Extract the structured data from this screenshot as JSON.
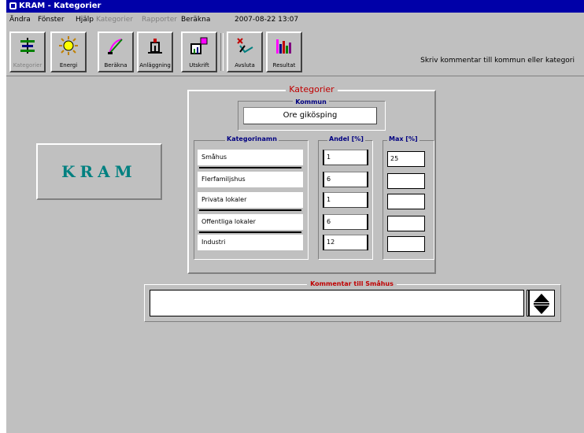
{
  "window": {
    "title": "KRAM - Kategorier"
  },
  "menu": {
    "items": [
      {
        "label": "Ändra",
        "enabled": true
      },
      {
        "label": "Fönster",
        "enabled": true
      },
      {
        "label": "Hjälp",
        "enabled": true
      },
      {
        "label": "Kategorier",
        "enabled": false
      },
      {
        "label": "Rapporter",
        "enabled": false
      },
      {
        "label": "Beräkna",
        "enabled": true
      },
      {
        "label": "2007-08-22  13:07",
        "enabled": true
      }
    ]
  },
  "toolbar": {
    "buttons": [
      {
        "label": "Kategorier",
        "icon": "sliders-icon",
        "enabled": false
      },
      {
        "label": "Energi",
        "icon": "sun-icon",
        "enabled": true
      },
      {
        "label": "Beräkna",
        "icon": "compass-arc-icon",
        "enabled": true
      },
      {
        "label": "Anläggning",
        "icon": "building-icon",
        "enabled": true
      },
      {
        "label": "Utskrift",
        "icon": "save-chart-icon",
        "enabled": true
      },
      {
        "label": "Avsluta",
        "icon": "exit-icon",
        "enabled": true
      },
      {
        "label": "Resultat",
        "icon": "bar-chart-icon",
        "enabled": true
      }
    ],
    "hint": "Skriv kommentar till kommun eller kategori"
  },
  "logo": {
    "text": "KRAM"
  },
  "kategorier": {
    "title": "Kategorier",
    "kommun_label": "Kommun",
    "kommun_value": "Ore gikösping",
    "col_kategori": "Kategorinamn",
    "col_andel": "Andel [%]",
    "col_max": "Max [%]",
    "rows": [
      {
        "name": "Småhus",
        "andel": "1",
        "max": "25"
      },
      {
        "name": "Flerfamiljshus",
        "andel": "6",
        "max": ""
      },
      {
        "name": "Privata lokaler",
        "andel": "1",
        "max": ""
      },
      {
        "name": "Offentliga lokaler",
        "andel": "6",
        "max": ""
      },
      {
        "name": "Industri",
        "andel": "12",
        "max": ""
      }
    ]
  },
  "comment": {
    "label": "Kommentar till Småhus",
    "value": ""
  }
}
